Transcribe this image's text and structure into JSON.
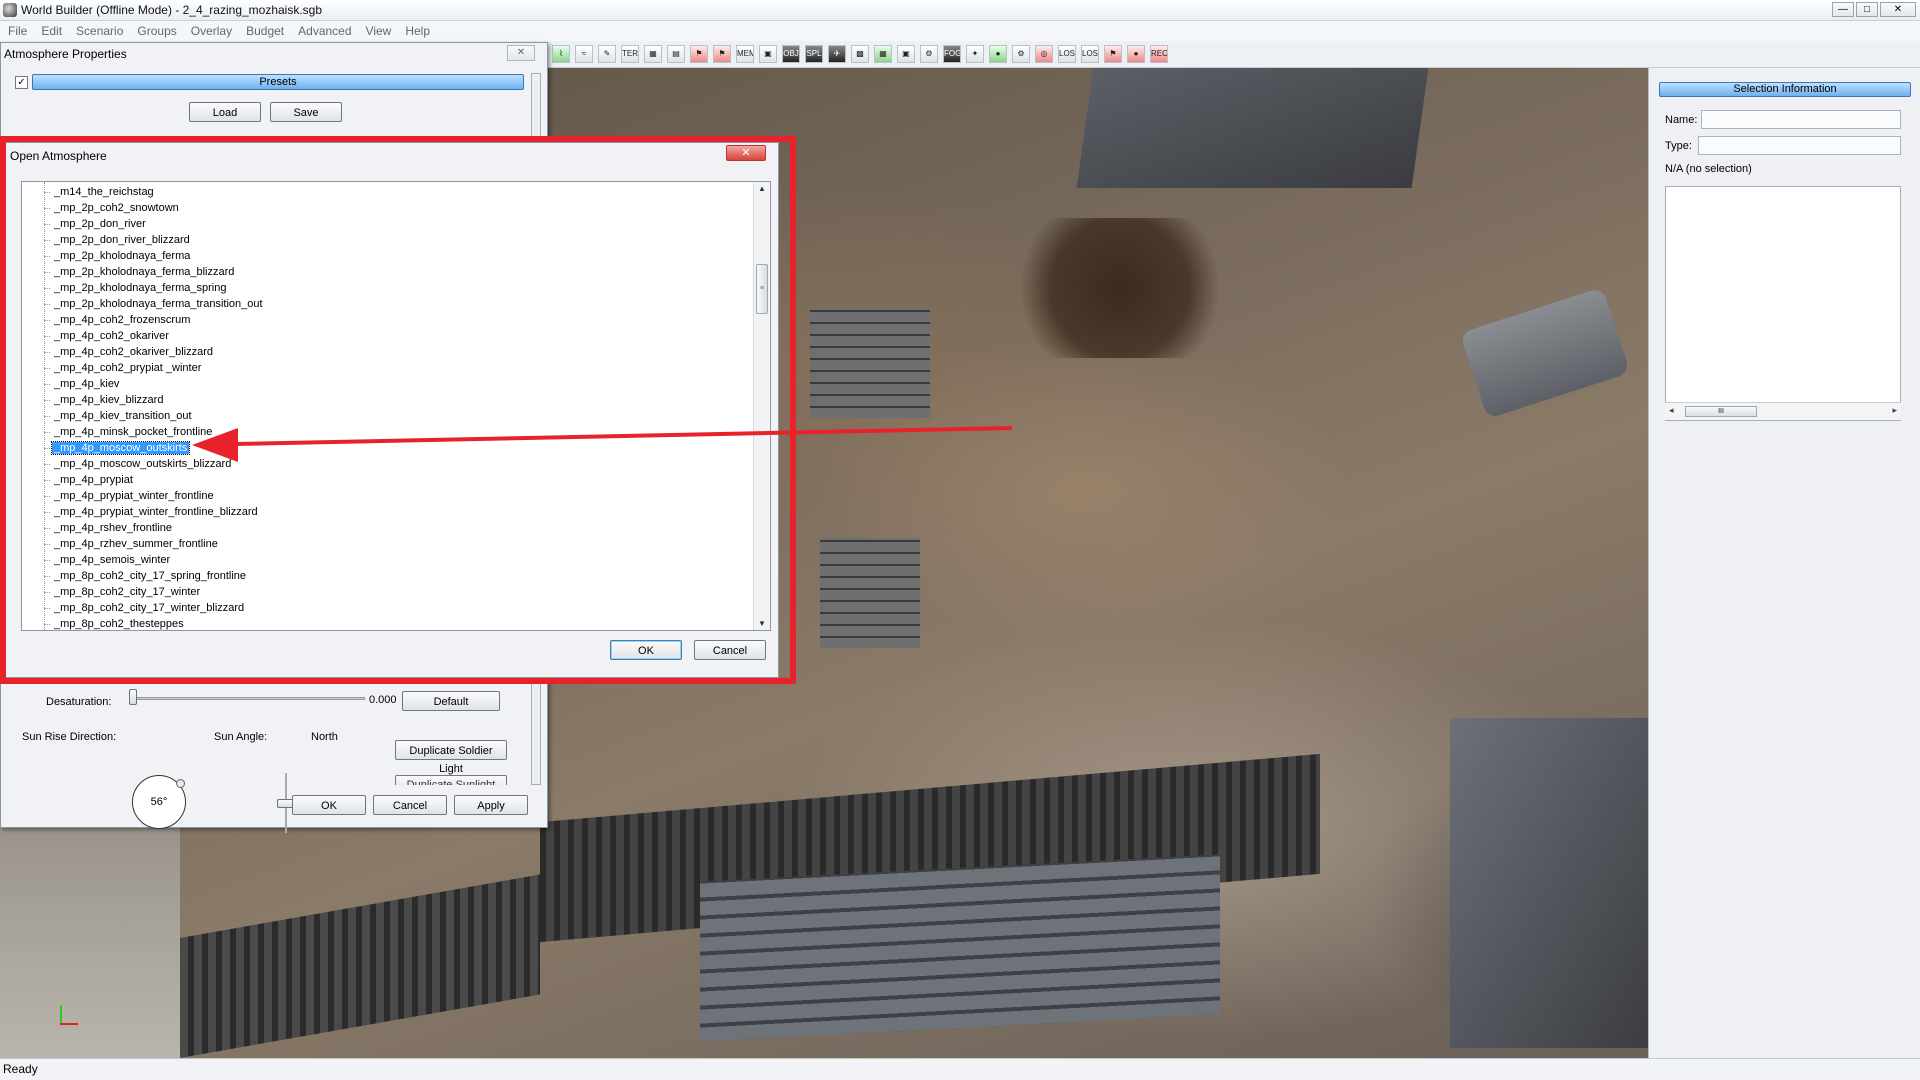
{
  "window": {
    "title": "World Builder (Offline Mode) - 2_4_razing_mozhaisk.sgb",
    "controls": {
      "minimize": "—",
      "maximize": "□",
      "close": "✕"
    }
  },
  "menu": [
    "File",
    "Edit",
    "Scenario",
    "Groups",
    "Overlay",
    "Budget",
    "Advanced",
    "View",
    "Help"
  ],
  "toolbar": {
    "buttons": [
      "⌇",
      "≈",
      "✎",
      "TER",
      "▦",
      "▤",
      "⚑",
      "⚑",
      "MEM",
      "▣",
      "OBJ",
      "SPL",
      "✈",
      "▩",
      "▦",
      "▣",
      "⚙",
      "FOG",
      "✦",
      "●",
      "⚙",
      "◎",
      "LOS",
      "LOS",
      "⚑",
      "●",
      "REC"
    ]
  },
  "atmosphere_properties": {
    "title": "Atmosphere Properties",
    "close_glyph": "✕",
    "checkbox_mark": "✓",
    "presets_label": "Presets",
    "load_label": "Load",
    "save_label": "Save",
    "desaturation_label": "Desaturation:",
    "desaturation_value": "0.000",
    "desaturation_fraction": 0.0,
    "default_label": "Default",
    "sun_rise_direction_label": "Sun Rise Direction:",
    "sun_rise_direction_value": "56°",
    "sun_angle_label": "Sun Angle:",
    "north_label": "North",
    "duplicate_soldier_light_label": "Duplicate Soldier Light",
    "duplicate_sunlight_label": "Duplicate Sunlight",
    "ok_label": "OK",
    "cancel_label": "Cancel",
    "apply_label": "Apply"
  },
  "open_atmosphere": {
    "title": "Open Atmosphere",
    "close_glyph": "✕",
    "ok_label": "OK",
    "cancel_label": "Cancel",
    "scroll_thumb_glyph": "≡",
    "scroll_up_glyph": "▲",
    "scroll_down_glyph": "▼",
    "selected_item": "_mp_4p_moscow_outskirts",
    "items": [
      "_m14_the_reichstag",
      "_mp_2p_coh2_snowtown",
      "_mp_2p_don_river",
      "_mp_2p_don_river_blizzard",
      "_mp_2p_kholodnaya_ferma",
      "_mp_2p_kholodnaya_ferma_blizzard",
      "_mp_2p_kholodnaya_ferma_spring",
      "_mp_2p_kholodnaya_ferma_transition_out",
      "_mp_4p_coh2_frozenscrum",
      "_mp_4p_coh2_okariver",
      "_mp_4p_coh2_okariver_blizzard",
      "_mp_4p_coh2_prypiat _winter",
      "_mp_4p_kiev",
      "_mp_4p_kiev_blizzard",
      "_mp_4p_kiev_transition_out",
      "_mp_4p_minsk_pocket_frontline",
      "_mp_4p_moscow_outskirts",
      "_mp_4p_moscow_outskirts_blizzard",
      "_mp_4p_prypiat",
      "_mp_4p_prypiat_winter_frontline",
      "_mp_4p_prypiat_winter_frontline_blizzard",
      "_mp_4p_rshev_frontline",
      "_mp_4p_rzhev_summer_frontline",
      "_mp_4p_semois_winter",
      "_mp_8p_coh2_city_17_spring_frontline",
      "_mp_8p_coh2_city_17_winter",
      "_mp_8p_coh2_city_17_winter_blizzard",
      "_mp_8p_coh2_thesteppes"
    ]
  },
  "selection_info": {
    "header": "Selection Information",
    "name_label": "Name:",
    "type_label": "Type:",
    "status": "N/A (no selection)",
    "scroll_thumb_glyph": "III",
    "scroll_left_glyph": "◂",
    "scroll_right_glyph": "▸"
  },
  "statusbar": {
    "text": "Ready"
  },
  "colors": {
    "annotation_red": "#e8222b",
    "selection_blue": "#3399ff",
    "header_blue": "#6fb0ef"
  }
}
